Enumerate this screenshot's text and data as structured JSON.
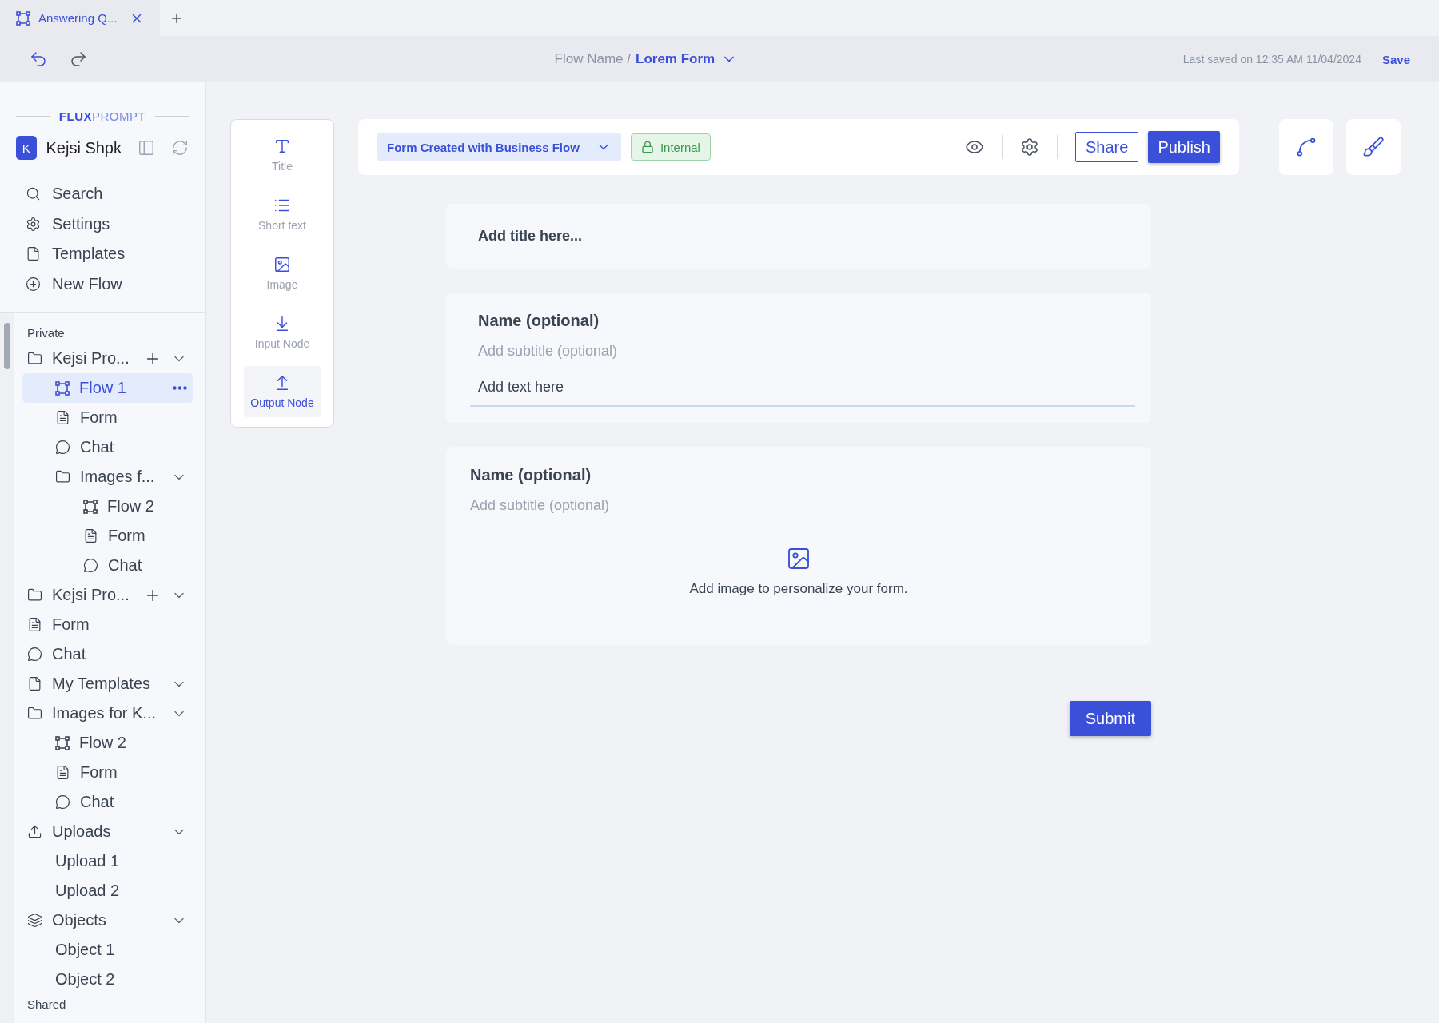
{
  "tabs": [
    {
      "label": "Answering Q...",
      "selected": true
    }
  ],
  "header": {
    "flow_name": "Flow Name /",
    "form_name": "Lorem Form",
    "last_saved": "Last saved on 12:35 AM 11/04/2024",
    "save": "Save"
  },
  "sidebar": {
    "brand_bold": "FLUX",
    "brand_light": "PROMPT",
    "user": {
      "initial": "K",
      "name": "Kejsi Shpk"
    },
    "nav": [
      {
        "kind": "search",
        "label": "Search"
      },
      {
        "kind": "settings",
        "label": "Settings"
      },
      {
        "kind": "template",
        "label": "Templates"
      },
      {
        "kind": "new",
        "label": "New Flow"
      }
    ],
    "private_label": "Private",
    "tree": [
      {
        "kind": "folder",
        "label": "Kejsi Pro...",
        "add": true,
        "expanded": true,
        "children": [
          {
            "kind": "flow",
            "label": "Flow 1",
            "selected": true
          },
          {
            "kind": "form",
            "label": "Form",
            "selected": false
          },
          {
            "kind": "chat",
            "label": "Chat",
            "selected": false
          },
          {
            "kind": "folder",
            "label": "Images f...",
            "expanded": true,
            "children": [
              {
                "kind": "flow",
                "label": "Flow 2",
                "selected": false
              },
              {
                "kind": "form",
                "label": "Form",
                "selected": false
              },
              {
                "kind": "chat",
                "label": "Chat",
                "selected": false
              }
            ]
          }
        ]
      },
      {
        "kind": "folder",
        "label": "Kejsi Pro...",
        "add": true,
        "expanded": true
      },
      {
        "kind": "form",
        "label": "Form",
        "selected": false
      },
      {
        "kind": "chat",
        "label": "Chat",
        "selected": false
      },
      {
        "kind": "template",
        "label": "My Templates",
        "expanded": true
      },
      {
        "kind": "folder",
        "label": "Images for K...",
        "expanded": true,
        "children": [
          {
            "kind": "flow",
            "label": "Flow 2",
            "selected": false
          },
          {
            "kind": "form",
            "label": "Form",
            "selected": false
          },
          {
            "kind": "chat",
            "label": "Chat",
            "selected": false
          }
        ]
      },
      {
        "kind": "upload",
        "label": "Uploads",
        "expanded": true,
        "children": [
          {
            "kind": "none",
            "label": "Upload 1",
            "selected": false
          },
          {
            "kind": "none",
            "label": "Upload 2",
            "selected": false
          }
        ]
      },
      {
        "kind": "objects",
        "label": "Objects",
        "expanded": true,
        "children": [
          {
            "kind": "none",
            "label": "Object 1",
            "selected": false
          },
          {
            "kind": "none",
            "label": "Object 2",
            "selected": false
          }
        ]
      }
    ],
    "shared_label": "Shared"
  },
  "palette": [
    {
      "kind": "title",
      "label": "Title",
      "selected": false
    },
    {
      "kind": "short",
      "label": "Short text",
      "selected": false
    },
    {
      "kind": "image",
      "label": "Image",
      "selected": false
    },
    {
      "kind": "input",
      "label": "Input Node",
      "selected": false
    },
    {
      "kind": "output",
      "label": "Output Node",
      "selected": true
    }
  ],
  "toolbar": {
    "form_select": "Form Created with Business Flow",
    "visibility": "Internal",
    "share": "Share",
    "publish": "Publish"
  },
  "form": {
    "title_placeholder": "Add title here...",
    "fields": [
      {
        "kind": "text",
        "name": "Name (optional)",
        "subtitle": "Add subtitle (optional)",
        "placeholder": "Add text here"
      },
      {
        "kind": "image",
        "name": "Name (optional)",
        "subtitle": "Add subtitle (optional)",
        "hint": "Add image to personalize your form."
      }
    ],
    "submit": "Submit"
  }
}
